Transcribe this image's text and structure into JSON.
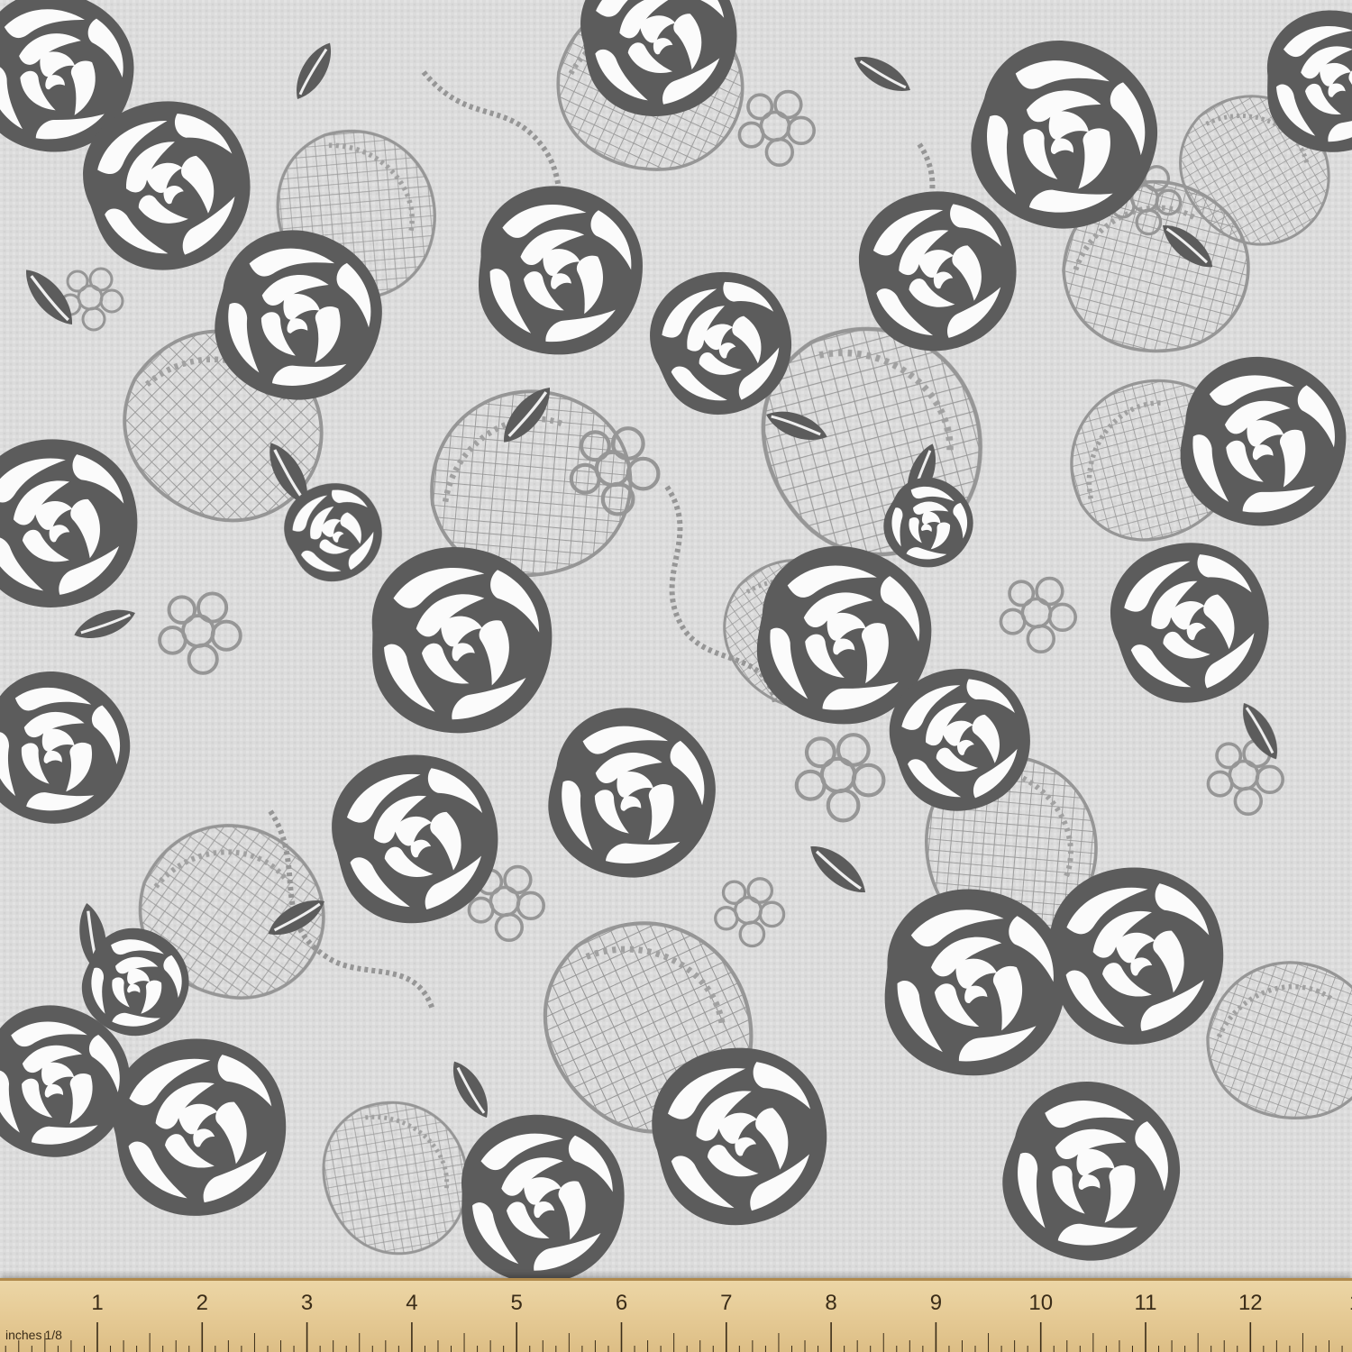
{
  "image": {
    "subject": "",
    "colors": {
      "background": "#dcdcdc",
      "rose": "#5c5c5c",
      "petal_highlight": "#fbfbfb",
      "lace": "#8e8e8e",
      "ruler": "#e6cb96",
      "ruler_ink": "#3a2c18"
    }
  },
  "ruler": {
    "unit_label": "inches",
    "fraction_label": "1/8",
    "numbers": [
      "1",
      "2",
      "3",
      "4",
      "5",
      "6",
      "7",
      "8",
      "9",
      "10",
      "11",
      "12",
      "1"
    ],
    "subdivisions_per_inch": 8
  }
}
